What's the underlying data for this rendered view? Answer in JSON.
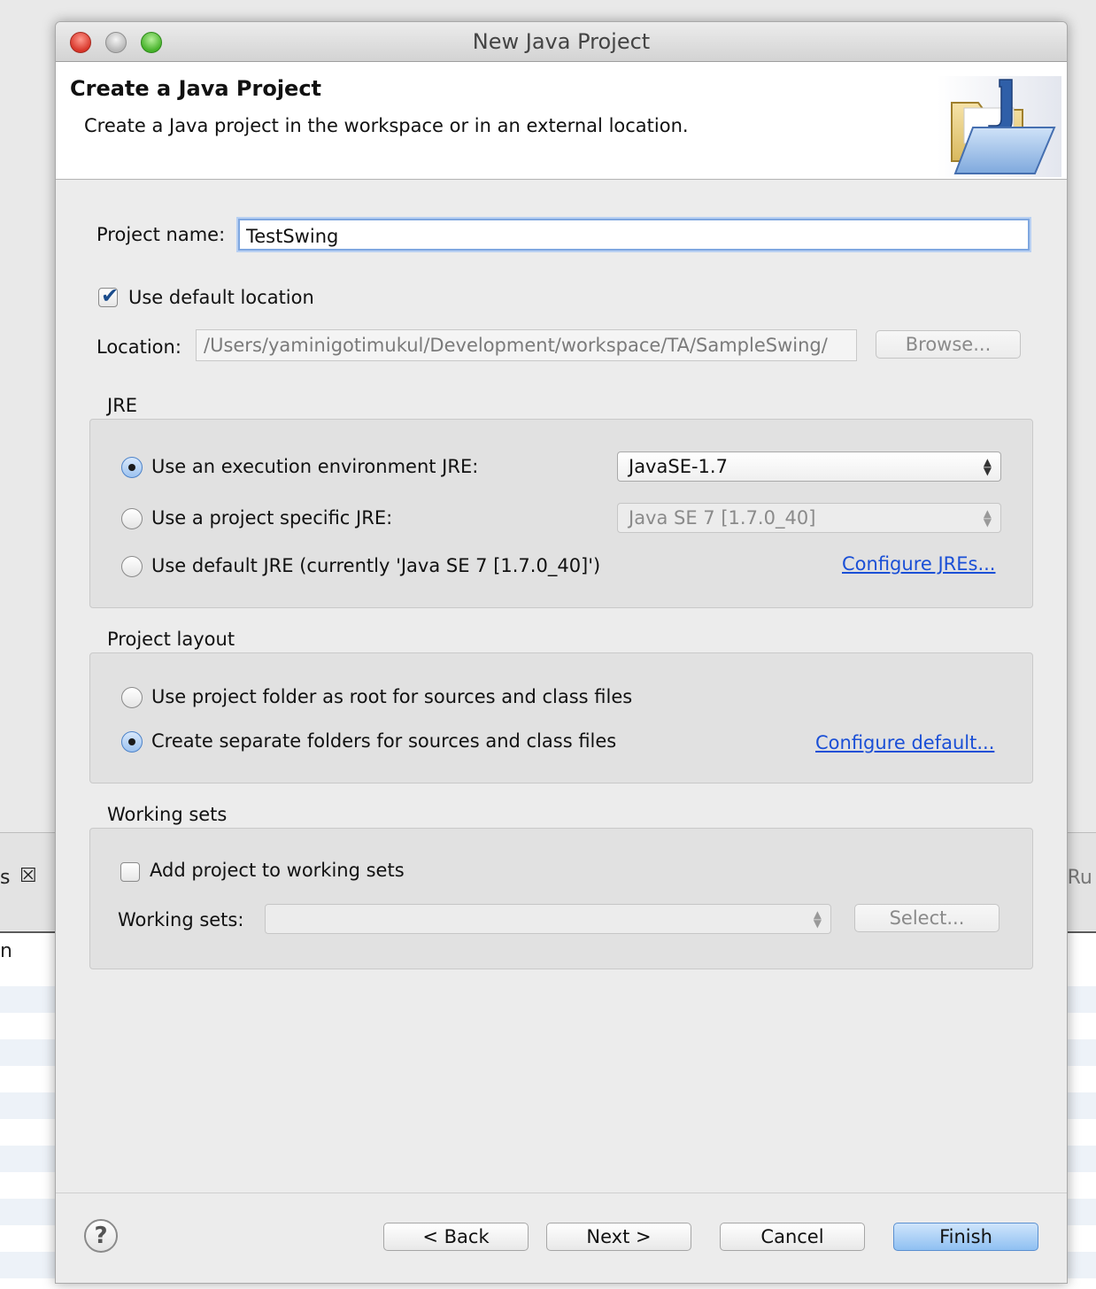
{
  "background": {
    "left_tab_text": "s",
    "left_tab_close": "☒",
    "left_row_text": "n",
    "right_tab_text": "t Ru"
  },
  "window": {
    "title": "New Java Project"
  },
  "header": {
    "title": "Create a Java Project",
    "description": "Create a Java project in the workspace or in an external location."
  },
  "project_name": {
    "label": "Project name:",
    "value": "TestSwing"
  },
  "default_location": {
    "label": "Use default location",
    "checked": true
  },
  "location": {
    "label": "Location:",
    "value": "/Users/yaminigotimukul/Development/workspace/TA/SampleSwing/",
    "browse_label": "Browse..."
  },
  "jre": {
    "group_label": "JRE",
    "option_exec_env": "Use an execution environment JRE:",
    "exec_env_value": "JavaSE-1.7",
    "option_project_specific": "Use a project specific JRE:",
    "project_specific_value": "Java SE 7 [1.7.0_40]",
    "option_default": "Use default JRE (currently 'Java SE 7 [1.7.0_40]')",
    "configure_link": "Configure JREs...",
    "selected": "exec_env"
  },
  "layout": {
    "group_label": "Project layout",
    "option_root": "Use project folder as root for sources and class files",
    "option_separate": "Create separate folders for sources and class files",
    "configure_link": "Configure default...",
    "selected": "separate"
  },
  "working_sets": {
    "group_label": "Working sets",
    "add_label": "Add project to working sets",
    "checked": false,
    "sets_label": "Working sets:",
    "sets_value": "",
    "select_label": "Select..."
  },
  "footer": {
    "help_glyph": "?",
    "back_label": "< Back",
    "next_label": "Next >",
    "cancel_label": "Cancel",
    "finish_label": "Finish"
  }
}
